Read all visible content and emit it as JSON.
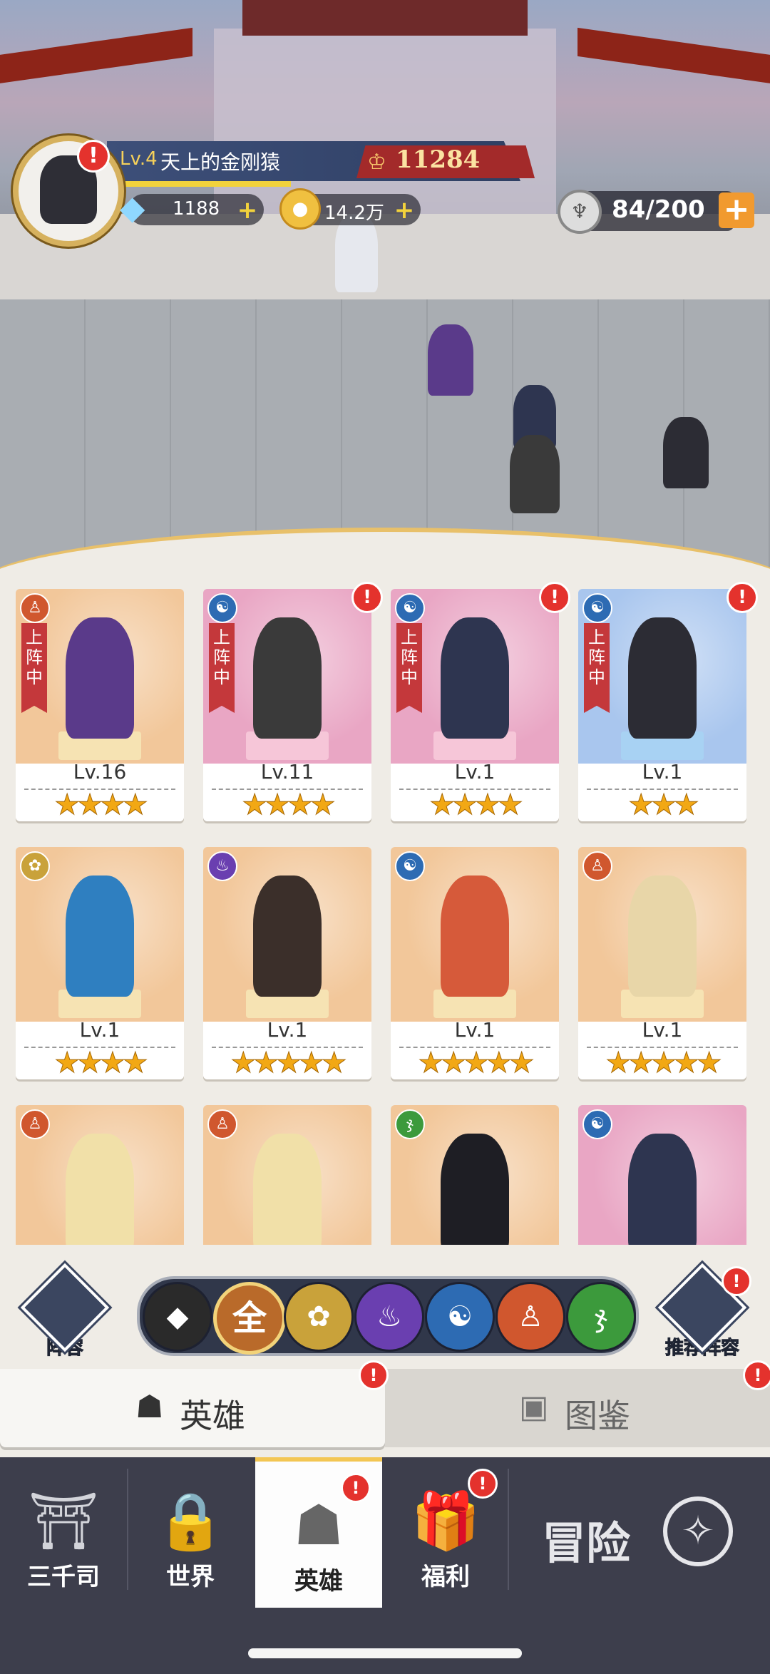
{
  "player": {
    "level_prefix": "Lv.4",
    "name": "天上的金刚猿",
    "power": "11284",
    "avatar_alert": "!",
    "gems": "1188",
    "coins": "14.2万",
    "stamina": "84/200",
    "plus": "+"
  },
  "heroes": [
    {
      "level": "Lv.16",
      "stars": "★★★★",
      "faction": "monk",
      "in_lineup": true,
      "alert": false,
      "bg": "#f2c79a",
      "hero_color": "#5a3a8a",
      "pedestal": "#f6e3b3"
    },
    {
      "level": "Lv.11",
      "stars": "★★★★",
      "faction": "yin-yang",
      "in_lineup": true,
      "alert": true,
      "bg": "#e9a6c4",
      "hero_color": "#3a3a3a",
      "pedestal": "#f6c6d8"
    },
    {
      "level": "Lv.1",
      "stars": "★★★★",
      "faction": "yin-yang",
      "in_lineup": true,
      "alert": true,
      "bg": "#e9a6c4",
      "hero_color": "#2e3550",
      "pedestal": "#f6c6d8"
    },
    {
      "level": "Lv.1",
      "stars": "★★★",
      "faction": "yin-yang",
      "in_lineup": true,
      "alert": true,
      "bg": "#a9c6ee",
      "hero_color": "#2c2c34",
      "pedestal": "#a8d2f3"
    },
    {
      "level": "Lv.1",
      "stars": "★★★★",
      "faction": "lotus",
      "in_lineup": false,
      "alert": false,
      "bg": "#f2c79a",
      "hero_color": "#2f7fc0",
      "pedestal": "#f6e3b3"
    },
    {
      "level": "Lv.1",
      "stars": "★★★★★",
      "faction": "flame",
      "in_lineup": false,
      "alert": false,
      "bg": "#f2c79a",
      "hero_color": "#3b2f2a",
      "pedestal": "#f6e3b3"
    },
    {
      "level": "Lv.1",
      "stars": "★★★★★",
      "faction": "yin-yang",
      "in_lineup": false,
      "alert": false,
      "bg": "#f2c79a",
      "hero_color": "#d65a3a",
      "pedestal": "#f6e3b3"
    },
    {
      "level": "Lv.1",
      "stars": "★★★★★",
      "faction": "monk",
      "in_lineup": false,
      "alert": false,
      "bg": "#f2c79a",
      "hero_color": "#e8d6a8",
      "pedestal": "#f6e3b3"
    },
    {
      "level": "",
      "stars": "",
      "faction": "monk",
      "in_lineup": false,
      "alert": false,
      "bg": "#f2c79a",
      "hero_color": "#f1e0a8",
      "pedestal": "#f6e3b3"
    },
    {
      "level": "",
      "stars": "",
      "faction": "monk",
      "in_lineup": false,
      "alert": false,
      "bg": "#f2c79a",
      "hero_color": "#f1e0a8",
      "pedestal": "#f6e3b3"
    },
    {
      "level": "",
      "stars": "",
      "faction": "dna",
      "in_lineup": false,
      "alert": false,
      "bg": "#f2c79a",
      "hero_color": "#1e1e24",
      "pedestal": "#f6e3b3"
    },
    {
      "level": "",
      "stars": "",
      "faction": "yin-yang",
      "in_lineup": false,
      "alert": false,
      "bg": "#e9a6c4",
      "hero_color": "#2e3550",
      "pedestal": "#f6c6d8"
    }
  ],
  "lineup_ribbon": "上阵中",
  "factions": {
    "monk": {
      "glyph": "♙",
      "color": "#d0572e"
    },
    "yin-yang": {
      "glyph": "☯",
      "color": "#2d6bb3"
    },
    "lotus": {
      "glyph": "✿",
      "color": "#c9a23a"
    },
    "flame": {
      "glyph": "♨",
      "color": "#6a3fb0"
    },
    "dna": {
      "glyph": "ჯ",
      "color": "#3c9a3c"
    }
  },
  "filters": {
    "lineup_label": "阵容",
    "recommend_label": "推荐阵容",
    "items": [
      {
        "key": "tank",
        "glyph": "◆",
        "color": "#2a2a2a",
        "selected": false
      },
      {
        "key": "all",
        "glyph": "全",
        "color": "#b96a2a",
        "selected": true
      },
      {
        "key": "lotus",
        "glyph": "✿",
        "color": "#c9a23a",
        "selected": false
      },
      {
        "key": "flame",
        "glyph": "♨",
        "color": "#6a3fb0",
        "selected": false
      },
      {
        "key": "yin-yang",
        "glyph": "☯",
        "color": "#2d6bb3",
        "selected": false
      },
      {
        "key": "monk",
        "glyph": "♙",
        "color": "#d0572e",
        "selected": false
      },
      {
        "key": "dna",
        "glyph": "ჯ",
        "color": "#3c9a3c",
        "selected": false
      }
    ]
  },
  "subtabs": {
    "heroes": "英雄",
    "codex": "图鉴"
  },
  "nav": {
    "items": [
      {
        "label": "三千司",
        "icon": "⛩",
        "alert": false
      },
      {
        "label": "世界",
        "icon": "🔒",
        "alert": false
      },
      {
        "label": "英雄",
        "icon": "☗",
        "alert": true
      },
      {
        "label": "福利",
        "icon": "🎁",
        "alert": true
      }
    ],
    "adventure": "冒险",
    "adventure_icon": "✧"
  }
}
